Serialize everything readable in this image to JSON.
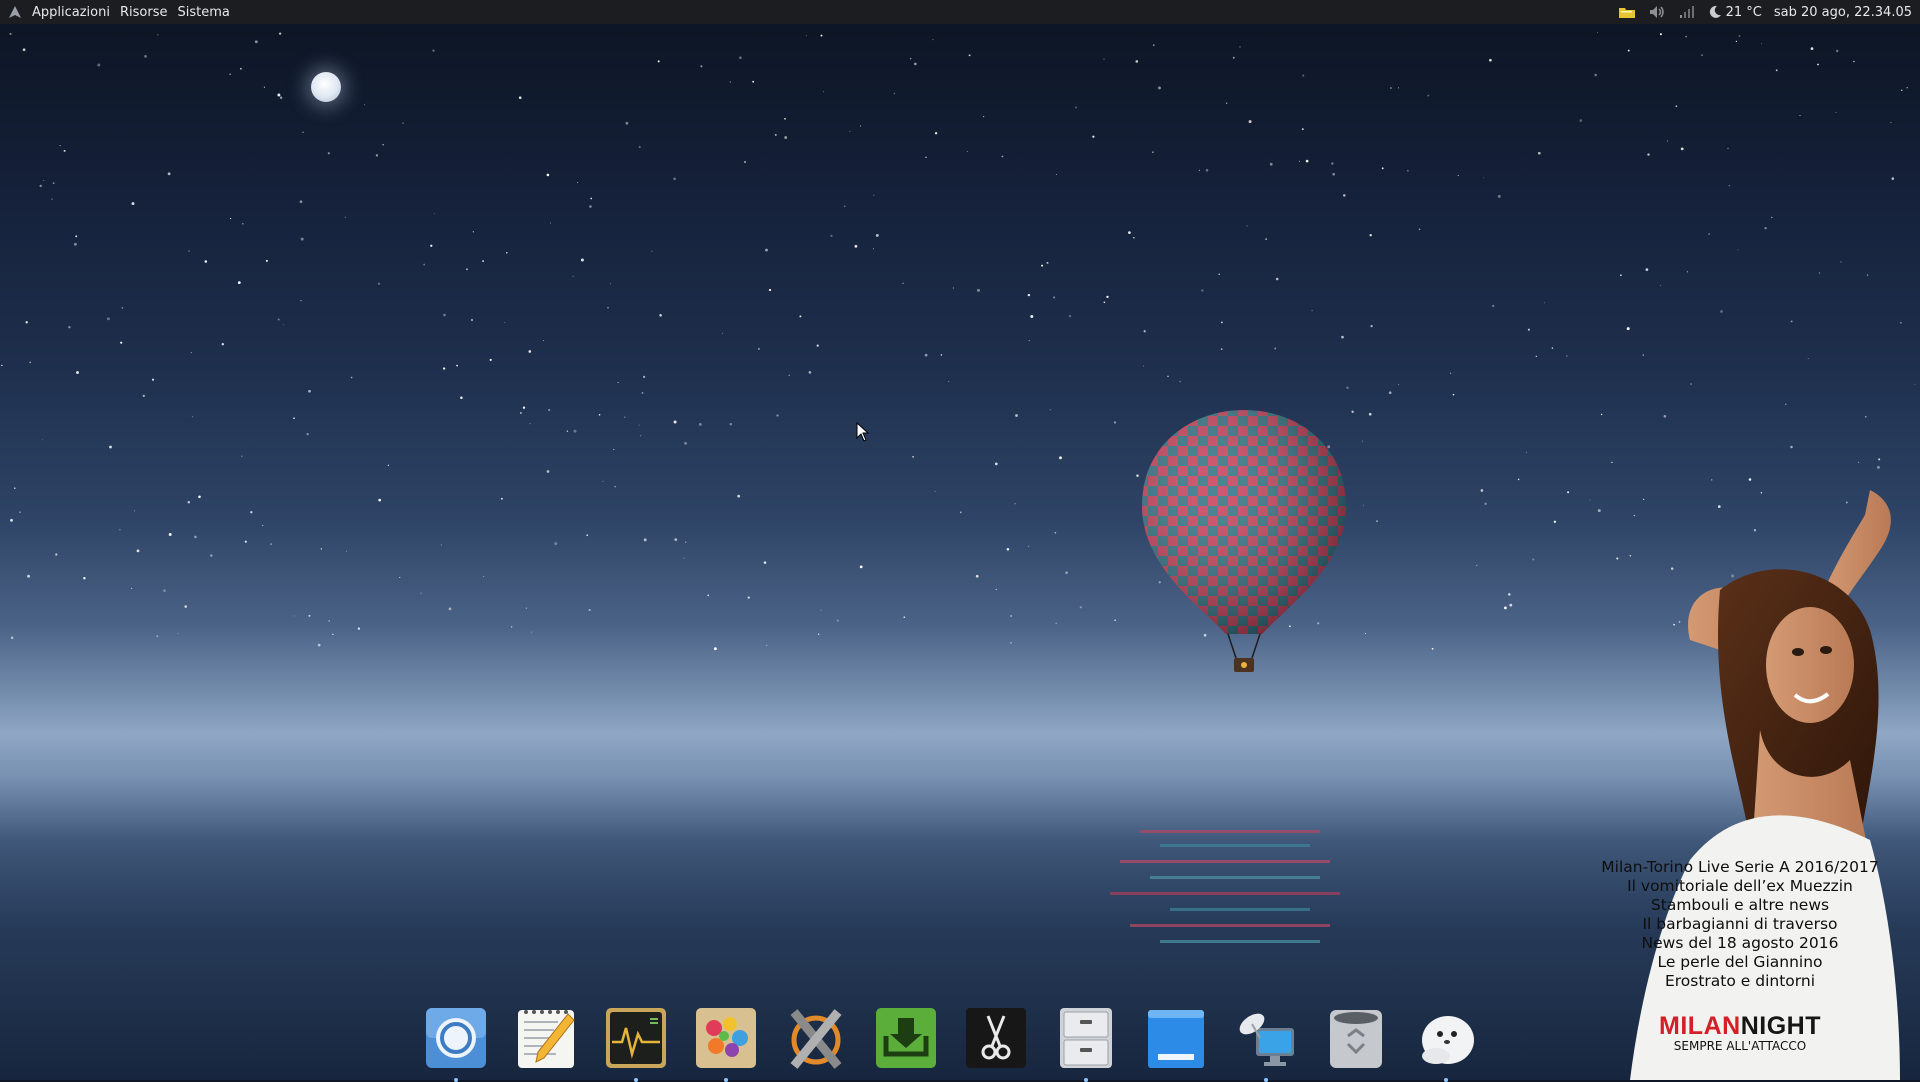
{
  "top_panel": {
    "menus": [
      "Applicazioni",
      "Risorse",
      "Sistema"
    ],
    "weather": "21 °C",
    "clock": "sab 20 ago, 22.34.05"
  },
  "news_widget": {
    "items": [
      "Milan-Torino Live Serie A 2016/2017",
      "Il vomitoriale dell’ex Muezzin",
      "Stambouli e altre news",
      "Il barbagianni di traverso",
      "News del 18 agosto 2016",
      "Le perle del Giannino",
      "Erostrato e dintorni"
    ],
    "brand_milan": "MILAN",
    "brand_night": "NIGHT",
    "brand_tagline": "SEMPRE ALL'ATTACCO"
  },
  "dock": {
    "items": [
      {
        "icon": "chromium-browser-icon"
      },
      {
        "icon": "text-editor-icon"
      },
      {
        "icon": "system-monitor-icon"
      },
      {
        "icon": "paint-palette-icon"
      },
      {
        "icon": "compiz-config-icon"
      },
      {
        "icon": "download-manager-icon"
      },
      {
        "icon": "scissors-screenshot-icon"
      },
      {
        "icon": "file-cabinet-icon"
      },
      {
        "icon": "blue-window-icon"
      },
      {
        "icon": "network-computer-icon"
      },
      {
        "icon": "trash-bin-icon"
      },
      {
        "icon": "seal-app-icon"
      }
    ]
  },
  "colors": {
    "panel_bg": "#1b1d21",
    "brand_red": "#d31f26",
    "dock_indicator": "#8ec6ff"
  }
}
